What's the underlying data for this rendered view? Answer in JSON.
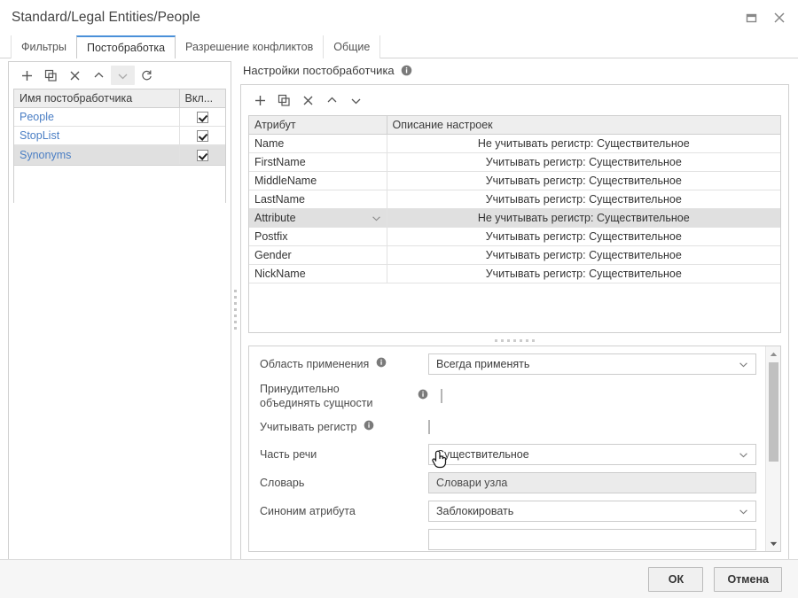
{
  "window": {
    "title": "Standard/Legal Entities/People",
    "controls": [
      {
        "name": "maximize-button",
        "icon": "maximize-icon"
      },
      {
        "name": "close-button",
        "icon": "close-icon"
      }
    ]
  },
  "tabs": [
    {
      "label": "Фильтры",
      "active": false
    },
    {
      "label": "Постобработка",
      "active": true
    },
    {
      "label": "Разрешение конфликтов",
      "active": false
    },
    {
      "label": "Общие",
      "active": false
    }
  ],
  "left_panel": {
    "toolbar": [
      {
        "name": "add-button",
        "icon": "plus-icon",
        "state": "normal"
      },
      {
        "name": "copy-button",
        "icon": "copy-icon",
        "state": "normal"
      },
      {
        "name": "delete-button",
        "icon": "close-x-icon",
        "state": "normal"
      },
      {
        "name": "move-up-button",
        "icon": "chevron-up-icon",
        "state": "normal"
      },
      {
        "name": "move-down-button",
        "icon": "chevron-down-icon",
        "state": "hover"
      },
      {
        "name": "refresh-button",
        "icon": "refresh-icon",
        "state": "normal"
      }
    ],
    "columns": [
      "Имя постобработчика",
      "Вкл..."
    ],
    "rows": [
      {
        "name": "People",
        "enabled": true,
        "selected": false
      },
      {
        "name": "StopList",
        "enabled": true,
        "selected": false
      },
      {
        "name": "Synonyms",
        "enabled": true,
        "selected": true
      }
    ]
  },
  "right_panel": {
    "caption": "Настройки постобработчика",
    "caption_info_icon": "info-icon",
    "toolbar": [
      {
        "name": "add-button",
        "icon": "plus-icon"
      },
      {
        "name": "copy-button",
        "icon": "copy-icon"
      },
      {
        "name": "delete-button",
        "icon": "close-x-icon"
      },
      {
        "name": "move-up-button",
        "icon": "chevron-up-icon"
      },
      {
        "name": "move-down-button",
        "icon": "chevron-down-icon"
      }
    ],
    "columns": [
      "Атрибут",
      "Описание настроек"
    ],
    "rows": [
      {
        "attribute": "Name",
        "description": "Не учитывать регистр: Существительное",
        "selected": false,
        "has_dropdown": false
      },
      {
        "attribute": "FirstName",
        "description": "Учитывать регистр: Существительное",
        "selected": false,
        "has_dropdown": false
      },
      {
        "attribute": "MiddleName",
        "description": "Учитывать регистр: Существительное",
        "selected": false,
        "has_dropdown": false
      },
      {
        "attribute": "LastName",
        "description": "Учитывать регистр: Существительное",
        "selected": false,
        "has_dropdown": false
      },
      {
        "attribute": "Attribute",
        "description": "Не учитывать регистр: Существительное",
        "selected": true,
        "has_dropdown": true
      },
      {
        "attribute": "Postfix",
        "description": "Учитывать регистр: Существительное",
        "selected": false,
        "has_dropdown": false
      },
      {
        "attribute": "Gender",
        "description": "Учитывать регистр: Существительное",
        "selected": false,
        "has_dropdown": false
      },
      {
        "attribute": "NickName",
        "description": "Учитывать регистр: Существительное",
        "selected": false,
        "has_dropdown": false
      }
    ]
  },
  "settings_form": {
    "fields": [
      {
        "name": "scope-of-application",
        "label": "Область применения",
        "info": true,
        "type": "select",
        "value": "Всегда применять"
      },
      {
        "name": "force-merge-entities",
        "label": "Принудительно объединять сущности",
        "info": true,
        "type": "checkbox",
        "checked": false
      },
      {
        "name": "case-sensitive",
        "label": "Учитывать регистр",
        "info": true,
        "type": "checkbox",
        "checked": false
      },
      {
        "name": "part-of-speech",
        "label": "Часть речи",
        "info": false,
        "type": "select",
        "value": "Существительное"
      },
      {
        "name": "dictionary",
        "label": "Словарь",
        "info": false,
        "type": "textbox",
        "value": "Словари узла"
      },
      {
        "name": "attribute-synonym",
        "label": "Синоним атрибута",
        "info": false,
        "type": "select",
        "value": "Заблокировать"
      }
    ]
  },
  "footer": {
    "ok_label": "ОК",
    "cancel_label": "Отмена"
  },
  "colors": {
    "accent": "#4a90d9",
    "link": "#4a7ec4",
    "selection": "#e0e0e0",
    "header_bg": "#eeeeee"
  }
}
